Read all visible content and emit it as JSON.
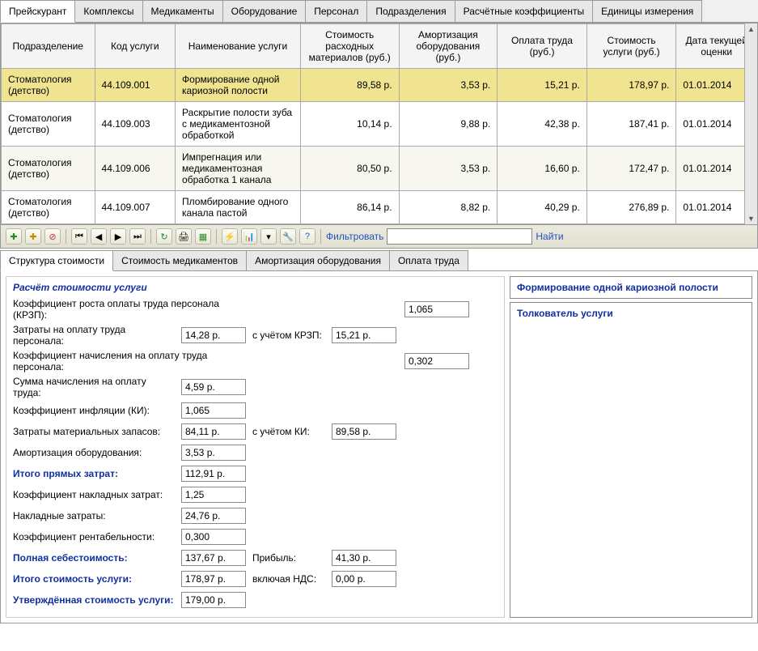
{
  "tabs": {
    "items": [
      "Прейскурант",
      "Комплексы",
      "Медикаменты",
      "Оборудование",
      "Персонал",
      "Подразделения",
      "Расчётные коэффициенты",
      "Единицы измерения"
    ],
    "active": 0
  },
  "grid": {
    "headers": [
      "Подразделение",
      "Код услуги",
      "Наименование услуги",
      "Стоимость расходных материалов (руб.)",
      "Амортизация оборудования (руб.)",
      "Оплата труда (руб.)",
      "Стоимость услуги (руб.)",
      "Дата текущей оценки"
    ],
    "rows": [
      {
        "sel": true,
        "dept": "Стоматология (детство)",
        "code": "44.109.001",
        "name": "Формирование одной кариозной полости",
        "mat": "89,58 р.",
        "amort": "3,53 р.",
        "labor": "15,21 р.",
        "cost": "178,97 р.",
        "date": "01.01.2014"
      },
      {
        "dept": "Стоматология (детство)",
        "code": "44.109.003",
        "name": "Раскрытие полости зуба с медикаментозной обработкой",
        "mat": "10,14 р.",
        "amort": "9,88 р.",
        "labor": "42,38 р.",
        "cost": "187,41 р.",
        "date": "01.01.2014"
      },
      {
        "alt": true,
        "dept": "Стоматология (детство)",
        "code": "44.109.006",
        "name": "Импрегнация или медикаментозная обработка 1 канала",
        "mat": "80,50 р.",
        "amort": "3,53 р.",
        "labor": "16,60 р.",
        "cost": "172,47 р.",
        "date": "01.01.2014"
      },
      {
        "dept": "Стоматология (детство)",
        "code": "44.109.007",
        "name": "Пломбирование одного канала пастой",
        "mat": "86,14 р.",
        "amort": "8,82 р.",
        "labor": "40,29 р.",
        "cost": "276,89 р.",
        "date": "01.01.2014"
      }
    ]
  },
  "toolbar": {
    "filter_label": "Фильтровать",
    "find_label": "Найти"
  },
  "subtabs": {
    "items": [
      "Структура стоимости",
      "Стоимость медикаментов",
      "Амортизация оборудования",
      "Оплата труда"
    ],
    "active": 0
  },
  "calc": {
    "title": "Расчёт стоимости услуги",
    "krzp_label": "Коэффициент роста оплаты труда персонала (КРЗП):",
    "krzp": "1,065",
    "labor_label": "Затраты на оплату труда персонала:",
    "labor": "14,28 р.",
    "with_krzp_label": "с учётом КРЗП:",
    "labor_krzp": "15,21 р.",
    "labor_coef_label": "Коэффициент начисления на оплату труда персонала:",
    "labor_coef": "0,302",
    "labor_sum_label": "Сумма начисления на оплату труда:",
    "labor_sum": "4,59 р.",
    "ki_label": "Коэффициент инфляции (КИ):",
    "ki": "1,065",
    "mat_label": "Затраты материальных запасов:",
    "mat": "84,11 р.",
    "with_ki_label": "с учётом КИ:",
    "mat_ki": "89,58 р.",
    "amort_label": "Амортизация оборудования:",
    "amort": "3,53 р.",
    "direct_label": "Итого прямых затрат:",
    "direct": "112,91 р.",
    "overhead_coef_label": "Коэффициент накладных затрат:",
    "overhead_coef": "1,25",
    "overhead_label": "Накладные затраты:",
    "overhead": "24,76 р.",
    "profit_coef_label": "Коэффициент рентабельности:",
    "profit_coef": "0,300",
    "full_cost_label": "Полная себестоимость:",
    "full_cost": "137,67 р.",
    "profit_label": "Прибыль:",
    "profit": "41,30 р.",
    "total_label": "Итого стоимость услуги:",
    "total": "178,97 р.",
    "vat_label": "включая НДС:",
    "vat": "0,00 р.",
    "approved_label": "Утверждённая стоимость услуги:",
    "approved": "179,00 р."
  },
  "right": {
    "service_name": "Формирование одной кариозной полости",
    "interp_title": "Толкователь услуги"
  }
}
